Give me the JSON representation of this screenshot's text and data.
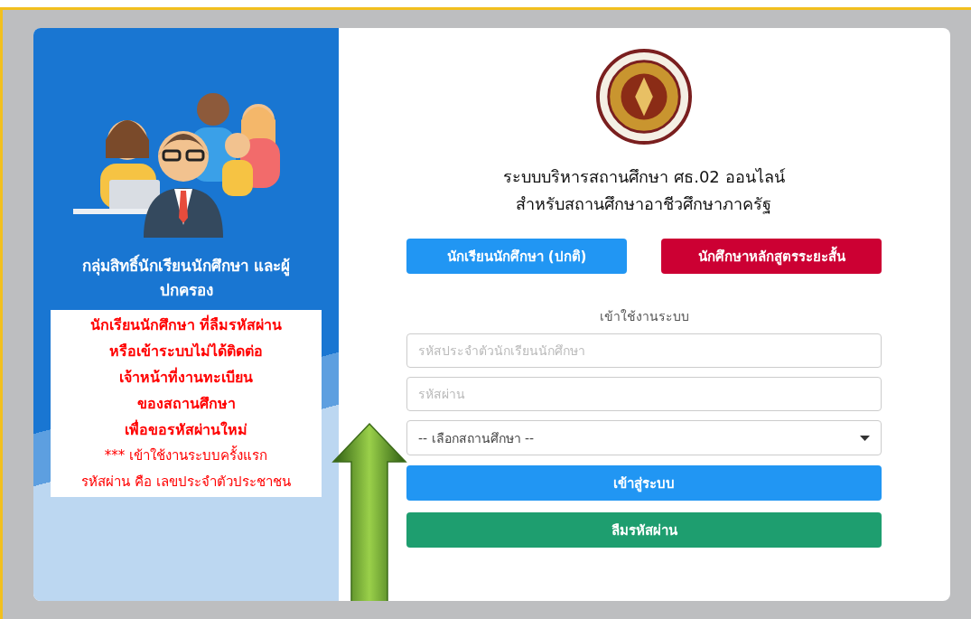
{
  "side_panel": {
    "heading": "กลุ่มสิทธิ์นักเรียนนักศึกษา และผู้ปกครอง",
    "notice": [
      {
        "text": "นักเรียนนักศึกษา ที่ลืมรหัสผ่าน",
        "bold": true
      },
      {
        "text": "หรือเข้าระบบไม่ได้ติดต่อ",
        "bold": true
      },
      {
        "text": "เจ้าหน้าที่งานทะเบียน",
        "bold": true
      },
      {
        "text": "ของสถานศึกษา",
        "bold": true
      },
      {
        "text": "เพื่อขอรหัสผ่านใหม่",
        "bold": true
      },
      {
        "text": "*** เข้าใช้งานระบบครั้งแรก",
        "bold": false
      },
      {
        "text": "รหัสผ่าน คือ เลขประจำตัวประชาชน",
        "bold": false
      }
    ]
  },
  "login": {
    "title_lines": [
      "ระบบบริหารสถานศึกษา ศธ.02 ออนไลน์",
      "สำหรับสถานศึกษาอาชีวศึกษาภาครัฐ"
    ],
    "mode_buttons": [
      {
        "label": "นักเรียนนักศึกษา (ปกติ)",
        "kind": "primary"
      },
      {
        "label": "นักศึกษาหลักสูตรระยะสั้น",
        "kind": "danger"
      }
    ],
    "section_label": "เข้าใช้งานระบบ",
    "student_id": {
      "placeholder": "รหัสประจำตัวนักเรียนนักศึกษา"
    },
    "password": {
      "placeholder": "รหัสผ่าน"
    },
    "school_select": {
      "value": "-- เลือกสถานศึกษา --"
    },
    "actions": [
      {
        "label": "เข้าสู่ระบบ",
        "kind": "primary"
      },
      {
        "label": "ลืมรหัสผ่าน",
        "kind": "success"
      }
    ]
  }
}
